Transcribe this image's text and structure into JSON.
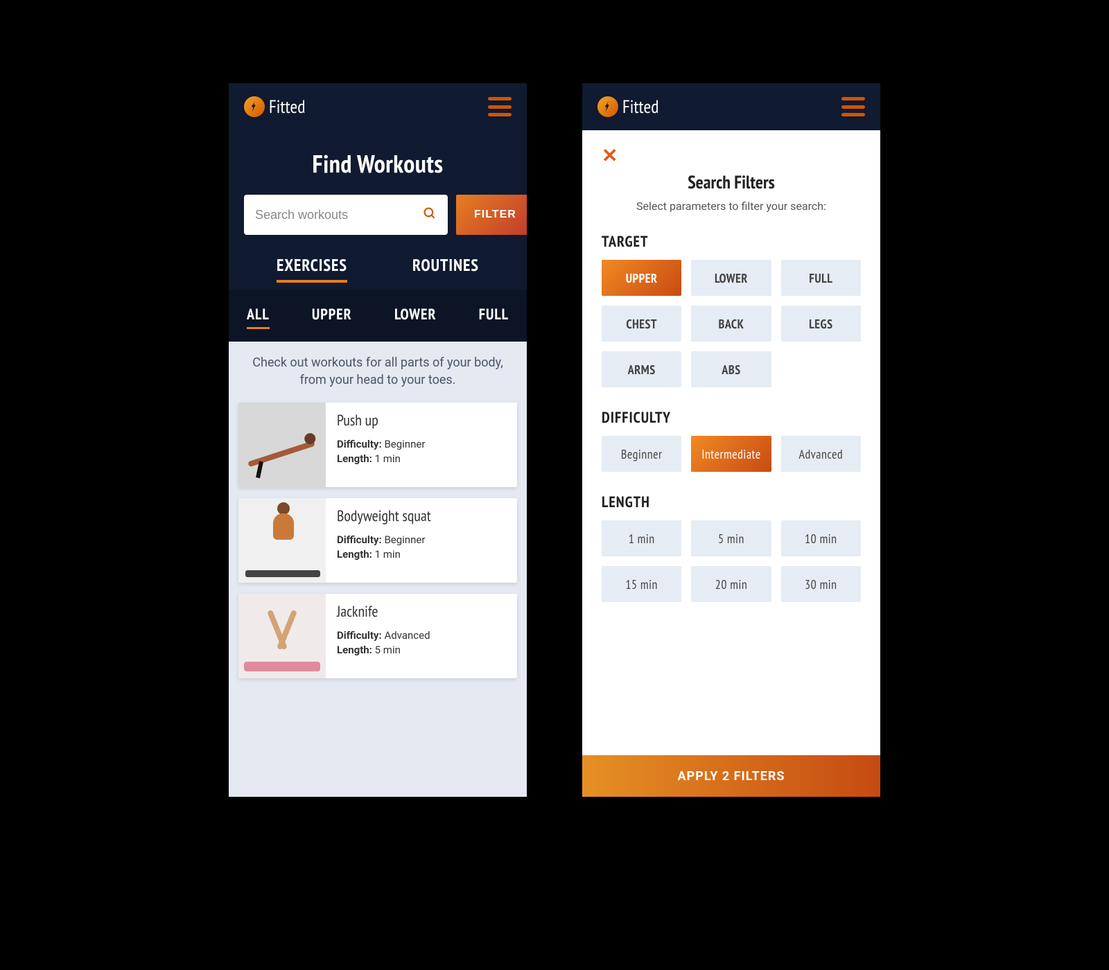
{
  "brand": {
    "name": "Fitted"
  },
  "left": {
    "page_title": "Find Workouts",
    "search": {
      "placeholder": "Search workouts"
    },
    "filter_button": "FILTER",
    "tabs": {
      "exercises": "EXERCISES",
      "routines": "ROUTINES",
      "active": "exercises"
    },
    "sub_tabs": {
      "items": [
        "ALL",
        "UPPER",
        "LOWER",
        "FULL"
      ],
      "active": "ALL"
    },
    "intro": "Check out workouts for all parts of your body, from your head to your toes.",
    "difficulty_label": "Difficulty:",
    "length_label": "Length:",
    "cards": [
      {
        "title": "Push up",
        "difficulty": "Beginner",
        "length": "1 min"
      },
      {
        "title": "Bodyweight squat",
        "difficulty": "Beginner",
        "length": "1 min"
      },
      {
        "title": "Jacknife",
        "difficulty": "Advanced",
        "length": "5 min"
      }
    ]
  },
  "right": {
    "title": "Search Filters",
    "subtitle": "Select parameters to filter your search:",
    "sections": {
      "target": {
        "label": "TARGET",
        "options": [
          "UPPER",
          "LOWER",
          "FULL",
          "CHEST",
          "BACK",
          "LEGS",
          "ARMS",
          "ABS"
        ],
        "active": "UPPER"
      },
      "difficulty": {
        "label": "DIFFICULTY",
        "options": [
          "Beginner",
          "Intermediate",
          "Advanced"
        ],
        "active": "Intermediate"
      },
      "length": {
        "label": "LENGTH",
        "options": [
          "1 min",
          "5 min",
          "10 min",
          "15 min",
          "20 min",
          "30 min"
        ],
        "active": null
      }
    },
    "apply_label": "APPLY 2 FILTERS"
  }
}
